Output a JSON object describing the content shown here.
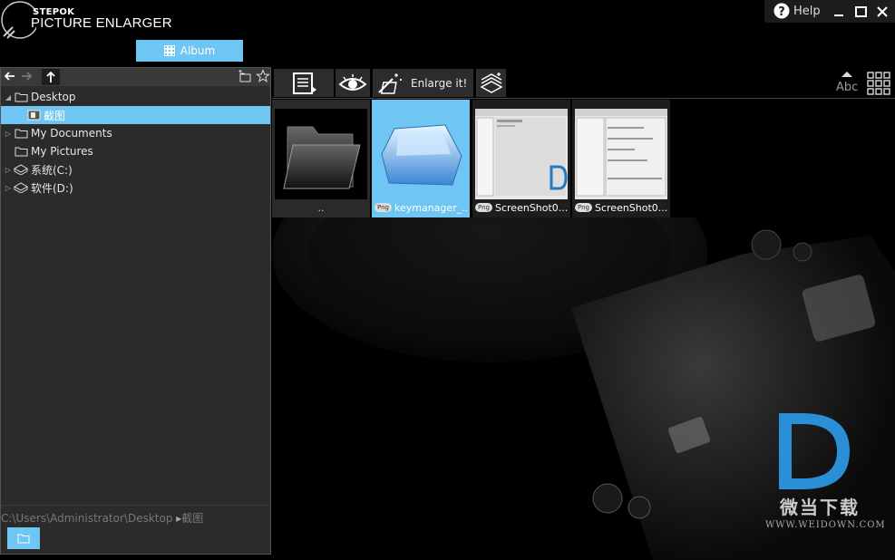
{
  "app": {
    "brand_top": "STEPOK",
    "brand_name": "PICTURE ENLARGER",
    "album_label": "Album",
    "help_label": "Help",
    "accent_color": "#6fc6f3"
  },
  "tree": {
    "items": [
      {
        "label": "Desktop",
        "icon": "folder-icon"
      },
      {
        "label": "截图",
        "icon": "image-folder-icon"
      },
      {
        "label": "My Documents",
        "icon": "folder-icon"
      },
      {
        "label": "My Pictures",
        "icon": "folder-icon"
      },
      {
        "label": "系统(C:)",
        "icon": "drive-icon"
      },
      {
        "label": "软件(D:)",
        "icon": "drive-icon"
      }
    ],
    "path": "C:\\Users\\Administrator\\Desktop",
    "path_current": "截图"
  },
  "toolbar": {
    "enlarge_label": "Enlarge it!",
    "sort_label": "Abc"
  },
  "thumbnails": [
    {
      "caption": "..",
      "badge": ""
    },
    {
      "caption": "keymanager_...",
      "badge": "Png"
    },
    {
      "caption": "ScreenShot0...",
      "badge": "Png"
    },
    {
      "caption": "ScreenShot0...",
      "badge": "Png"
    }
  ],
  "watermark": {
    "cn": "微当下载",
    "url": "WWW.WEIDOWN.COM"
  }
}
